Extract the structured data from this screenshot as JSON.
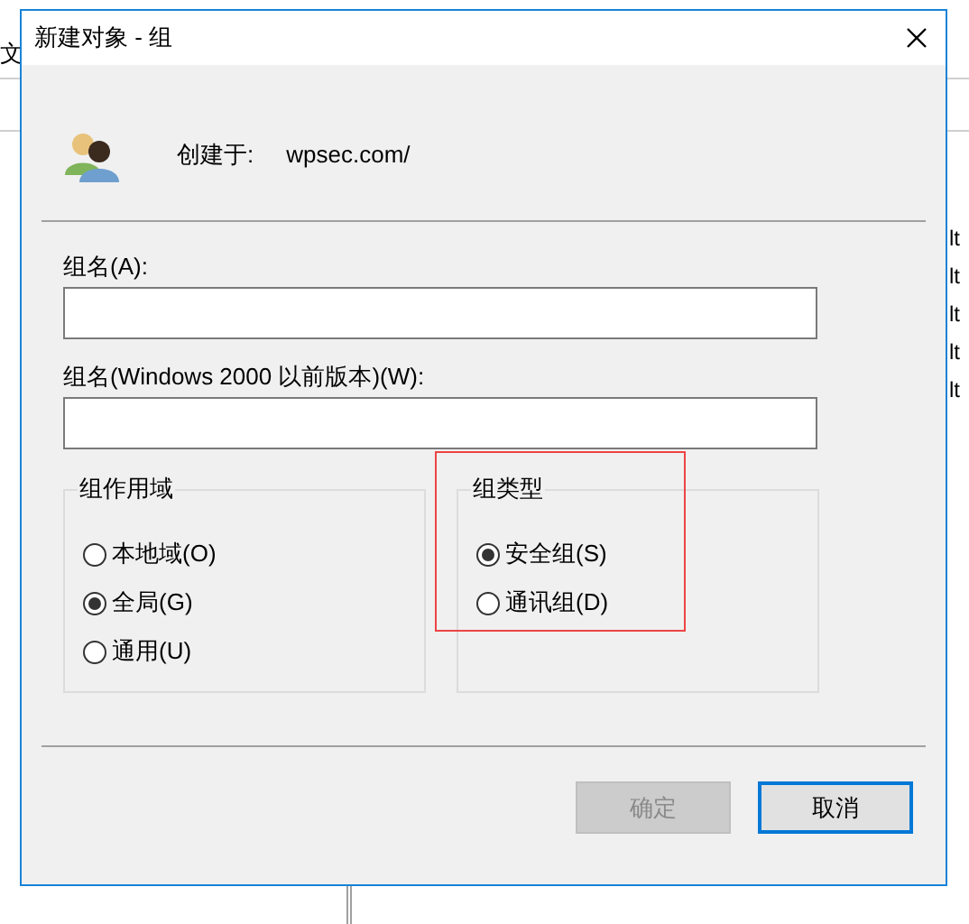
{
  "background_window": {
    "menu_fragment": "文",
    "list_fragments": [
      "lt",
      "lt",
      "lt",
      "lt",
      "lt"
    ]
  },
  "dialog": {
    "title": "新建对象 - 组",
    "created_in_label": "创建于:",
    "created_in_value": "wpsec.com/",
    "fields": [
      {
        "label": "组名(A):"
      },
      {
        "label": "组名(Windows 2000 以前版本)(W):"
      }
    ],
    "groups": [
      {
        "title": "组作用域",
        "highlighted": false,
        "options": [
          {
            "label": "本地域(O)",
            "selected": false
          },
          {
            "label": "全局(G)",
            "selected": true
          },
          {
            "label": "通用(U)",
            "selected": false
          }
        ]
      },
      {
        "title": "组类型",
        "highlighted": true,
        "options": [
          {
            "label": "安全组(S)",
            "selected": true
          },
          {
            "label": "通讯组(D)",
            "selected": false
          }
        ]
      }
    ],
    "buttons": [
      {
        "label": "确定",
        "disabled": true,
        "default": false
      },
      {
        "label": "取消",
        "disabled": false,
        "default": true
      }
    ]
  }
}
